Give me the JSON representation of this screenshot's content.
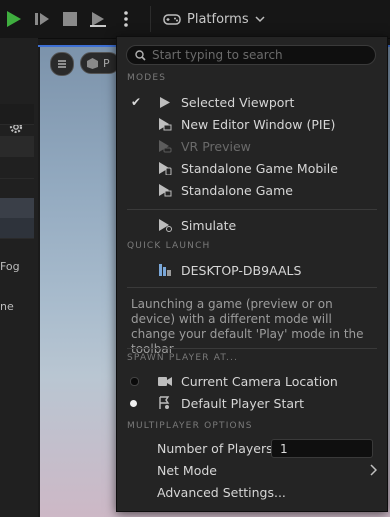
{
  "toolbar": {
    "platforms_label": "Platforms"
  },
  "left_panel": {
    "text_fog": "Fog",
    "text_ne": "ne"
  },
  "viewport": {
    "pill_text": "P"
  },
  "menu": {
    "search_placeholder": "Start typing to search",
    "modes_header": "MODES",
    "modes": [
      {
        "label": "Selected Viewport",
        "checked": true,
        "icon": "play-icon"
      },
      {
        "label": "New Editor Window (PIE)",
        "checked": false,
        "icon": "editor-window-icon"
      },
      {
        "label": "VR Preview",
        "checked": false,
        "icon": "vr-preview-icon",
        "disabled": true
      },
      {
        "label": "Standalone Game Mobile",
        "checked": false,
        "icon": "mobile-icon"
      },
      {
        "label": "Standalone Game",
        "checked": false,
        "icon": "standalone-icon"
      }
    ],
    "simulate_label": "Simulate",
    "quick_launch_header": "QUICK LAUNCH",
    "quick_launch_device": "DESKTOP-DB9AALS",
    "note": "Launching a game (preview or on device) with a different mode will change your default 'Play' mode in the toolbar",
    "spawn_header": "SPAWN PLAYER AT...",
    "spawn_options": [
      {
        "label": "Current Camera Location",
        "selected": false
      },
      {
        "label": "Default Player Start",
        "selected": true
      }
    ],
    "multiplayer_header": "MULTIPLAYER OPTIONS",
    "num_players_label": "Number of Players",
    "num_players_value": "1",
    "net_mode_label": "Net Mode",
    "advanced_label": "Advanced Settings..."
  },
  "colors": {
    "play_green": "#3fae3f",
    "accent_blue": "#3d6fd3",
    "menu_bg": "#242424"
  }
}
